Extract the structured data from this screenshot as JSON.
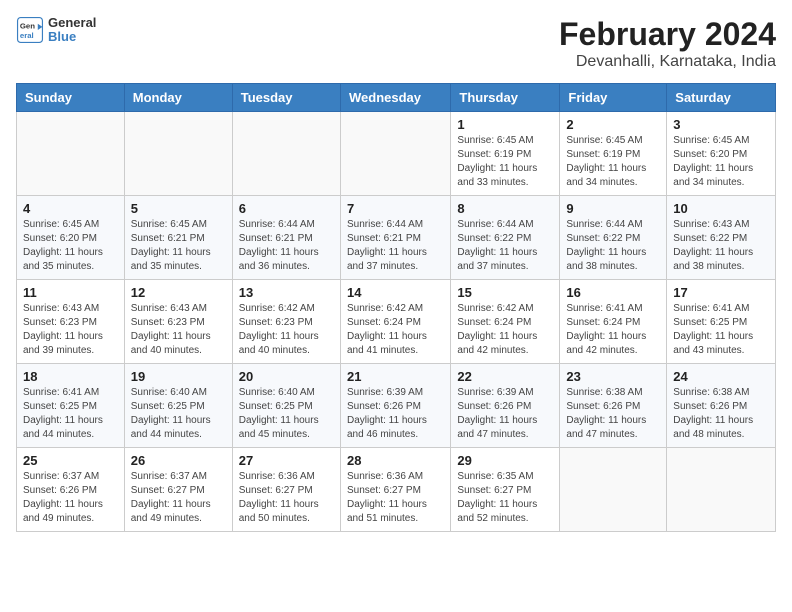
{
  "header": {
    "logo_line1": "General",
    "logo_line2": "Blue",
    "title": "February 2024",
    "subtitle": "Devanhalli, Karnataka, India"
  },
  "days_of_week": [
    "Sunday",
    "Monday",
    "Tuesday",
    "Wednesday",
    "Thursday",
    "Friday",
    "Saturday"
  ],
  "weeks": [
    [
      {
        "day": "",
        "info": ""
      },
      {
        "day": "",
        "info": ""
      },
      {
        "day": "",
        "info": ""
      },
      {
        "day": "",
        "info": ""
      },
      {
        "day": "1",
        "info": "Sunrise: 6:45 AM\nSunset: 6:19 PM\nDaylight: 11 hours\nand 33 minutes."
      },
      {
        "day": "2",
        "info": "Sunrise: 6:45 AM\nSunset: 6:19 PM\nDaylight: 11 hours\nand 34 minutes."
      },
      {
        "day": "3",
        "info": "Sunrise: 6:45 AM\nSunset: 6:20 PM\nDaylight: 11 hours\nand 34 minutes."
      }
    ],
    [
      {
        "day": "4",
        "info": "Sunrise: 6:45 AM\nSunset: 6:20 PM\nDaylight: 11 hours\nand 35 minutes."
      },
      {
        "day": "5",
        "info": "Sunrise: 6:45 AM\nSunset: 6:21 PM\nDaylight: 11 hours\nand 35 minutes."
      },
      {
        "day": "6",
        "info": "Sunrise: 6:44 AM\nSunset: 6:21 PM\nDaylight: 11 hours\nand 36 minutes."
      },
      {
        "day": "7",
        "info": "Sunrise: 6:44 AM\nSunset: 6:21 PM\nDaylight: 11 hours\nand 37 minutes."
      },
      {
        "day": "8",
        "info": "Sunrise: 6:44 AM\nSunset: 6:22 PM\nDaylight: 11 hours\nand 37 minutes."
      },
      {
        "day": "9",
        "info": "Sunrise: 6:44 AM\nSunset: 6:22 PM\nDaylight: 11 hours\nand 38 minutes."
      },
      {
        "day": "10",
        "info": "Sunrise: 6:43 AM\nSunset: 6:22 PM\nDaylight: 11 hours\nand 38 minutes."
      }
    ],
    [
      {
        "day": "11",
        "info": "Sunrise: 6:43 AM\nSunset: 6:23 PM\nDaylight: 11 hours\nand 39 minutes."
      },
      {
        "day": "12",
        "info": "Sunrise: 6:43 AM\nSunset: 6:23 PM\nDaylight: 11 hours\nand 40 minutes."
      },
      {
        "day": "13",
        "info": "Sunrise: 6:42 AM\nSunset: 6:23 PM\nDaylight: 11 hours\nand 40 minutes."
      },
      {
        "day": "14",
        "info": "Sunrise: 6:42 AM\nSunset: 6:24 PM\nDaylight: 11 hours\nand 41 minutes."
      },
      {
        "day": "15",
        "info": "Sunrise: 6:42 AM\nSunset: 6:24 PM\nDaylight: 11 hours\nand 42 minutes."
      },
      {
        "day": "16",
        "info": "Sunrise: 6:41 AM\nSunset: 6:24 PM\nDaylight: 11 hours\nand 42 minutes."
      },
      {
        "day": "17",
        "info": "Sunrise: 6:41 AM\nSunset: 6:25 PM\nDaylight: 11 hours\nand 43 minutes."
      }
    ],
    [
      {
        "day": "18",
        "info": "Sunrise: 6:41 AM\nSunset: 6:25 PM\nDaylight: 11 hours\nand 44 minutes."
      },
      {
        "day": "19",
        "info": "Sunrise: 6:40 AM\nSunset: 6:25 PM\nDaylight: 11 hours\nand 44 minutes."
      },
      {
        "day": "20",
        "info": "Sunrise: 6:40 AM\nSunset: 6:25 PM\nDaylight: 11 hours\nand 45 minutes."
      },
      {
        "day": "21",
        "info": "Sunrise: 6:39 AM\nSunset: 6:26 PM\nDaylight: 11 hours\nand 46 minutes."
      },
      {
        "day": "22",
        "info": "Sunrise: 6:39 AM\nSunset: 6:26 PM\nDaylight: 11 hours\nand 47 minutes."
      },
      {
        "day": "23",
        "info": "Sunrise: 6:38 AM\nSunset: 6:26 PM\nDaylight: 11 hours\nand 47 minutes."
      },
      {
        "day": "24",
        "info": "Sunrise: 6:38 AM\nSunset: 6:26 PM\nDaylight: 11 hours\nand 48 minutes."
      }
    ],
    [
      {
        "day": "25",
        "info": "Sunrise: 6:37 AM\nSunset: 6:26 PM\nDaylight: 11 hours\nand 49 minutes."
      },
      {
        "day": "26",
        "info": "Sunrise: 6:37 AM\nSunset: 6:27 PM\nDaylight: 11 hours\nand 49 minutes."
      },
      {
        "day": "27",
        "info": "Sunrise: 6:36 AM\nSunset: 6:27 PM\nDaylight: 11 hours\nand 50 minutes."
      },
      {
        "day": "28",
        "info": "Sunrise: 6:36 AM\nSunset: 6:27 PM\nDaylight: 11 hours\nand 51 minutes."
      },
      {
        "day": "29",
        "info": "Sunrise: 6:35 AM\nSunset: 6:27 PM\nDaylight: 11 hours\nand 52 minutes."
      },
      {
        "day": "",
        "info": ""
      },
      {
        "day": "",
        "info": ""
      }
    ]
  ]
}
